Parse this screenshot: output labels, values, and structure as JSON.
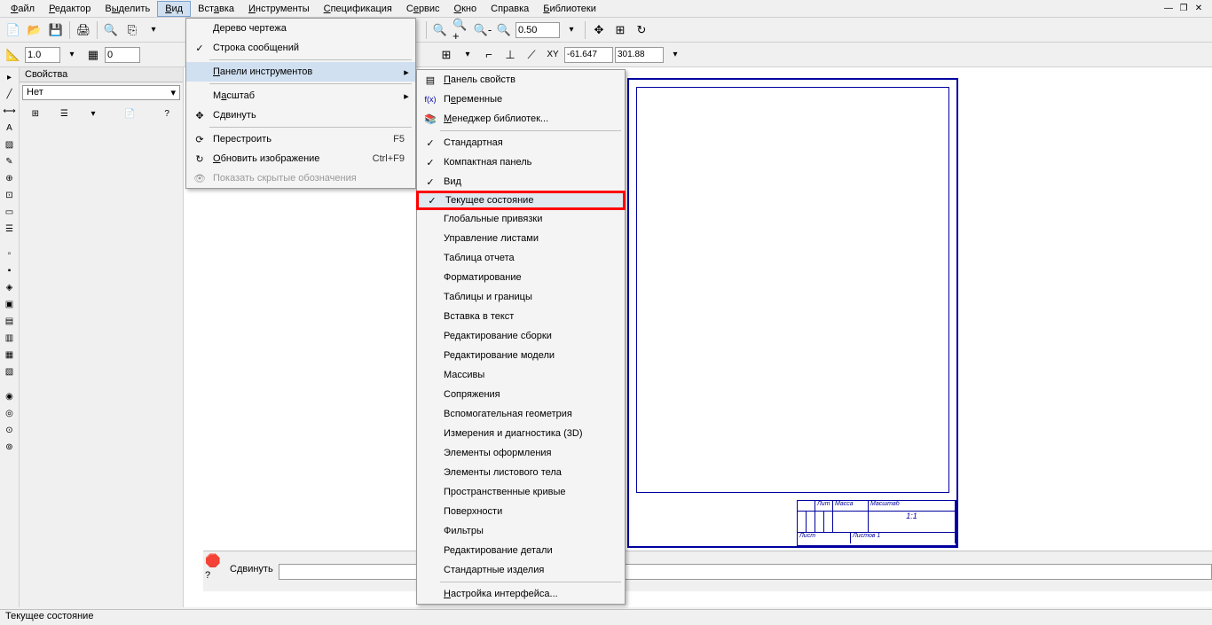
{
  "menubar": {
    "file": "Файл",
    "editor": "Редактор",
    "select": "Выделить",
    "view": "Вид",
    "insert": "Вставка",
    "tools": "Инструменты",
    "spec": "Спецификация",
    "service": "Сервис",
    "window": "Окно",
    "help": "Справка",
    "libraries": "Библиотеки"
  },
  "toolbar": {
    "zoom_value": "0.50",
    "scale_value": "1.0",
    "step_value": "0",
    "coord_x": "-61.647",
    "coord_y": "301.88"
  },
  "props": {
    "title": "Свойства",
    "dropdown": "Нет"
  },
  "view_menu": {
    "tree": "Дерево чертежа",
    "msgline": "Строка сообщений",
    "toolbars": "Панели инструментов",
    "scale": "Масштаб",
    "move": "Сдвинуть",
    "rebuild": "Перестроить",
    "rebuild_key": "F5",
    "refresh": "Обновить изображение",
    "refresh_key": "Ctrl+F9",
    "hidden": "Показать скрытые обозначения"
  },
  "toolbars_submenu": {
    "props_panel": "Панель свойств",
    "variables": "Переменные",
    "lib_manager": "Менеджер библиотек...",
    "standard": "Стандартная",
    "compact": "Компактная панель",
    "view": "Вид",
    "current_state": "Текущее состояние",
    "global_snaps": "Глобальные привязки",
    "sheet_mgmt": "Управление листами",
    "report_table": "Таблица отчета",
    "formatting": "Форматирование",
    "tables_borders": "Таблицы и границы",
    "insert_text": "Вставка в текст",
    "edit_assembly": "Редактирование сборки",
    "edit_model": "Редактирование модели",
    "arrays": "Массивы",
    "mates": "Сопряжения",
    "aux_geom": "Вспомогательная геометрия",
    "measure_3d": "Измерения и диагностика (3D)",
    "design_elements": "Элементы оформления",
    "sheet_body": "Элементы листового тела",
    "space_curves": "Пространственные кривые",
    "surfaces": "Поверхности",
    "filters": "Фильтры",
    "edit_part": "Редактирование детали",
    "std_products": "Стандартные изделия",
    "ui_config": "Настройка интерфейса..."
  },
  "title_block": {
    "lit": "Лит",
    "mass": "Масса",
    "scale": "Масштаб",
    "ratio": "1:1",
    "sheet": "Лист",
    "sheets": "Листов  1"
  },
  "bottom": {
    "move_label": "Сдвинуть"
  },
  "status": {
    "text": "Текущее состояние"
  }
}
